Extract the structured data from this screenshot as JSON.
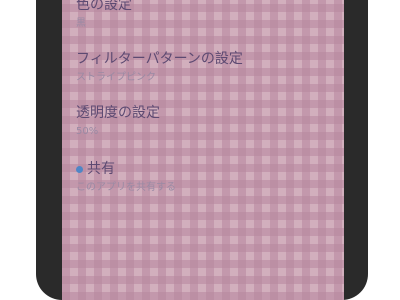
{
  "settings": {
    "color": {
      "title": "色の設定",
      "summary": "黒"
    },
    "filter_pattern": {
      "title": "フィルターパターンの設定",
      "summary": "ストライプピンク"
    },
    "opacity": {
      "title": "透明度の設定",
      "summary": "50%"
    },
    "share": {
      "title": "共有",
      "summary": "このアプリを共有する"
    }
  },
  "colors": {
    "accent_dot": "#4f86c6",
    "title_text": "#5d4a72",
    "summary_text": "#9a8aa4",
    "bezel": "#2a2a2a"
  }
}
